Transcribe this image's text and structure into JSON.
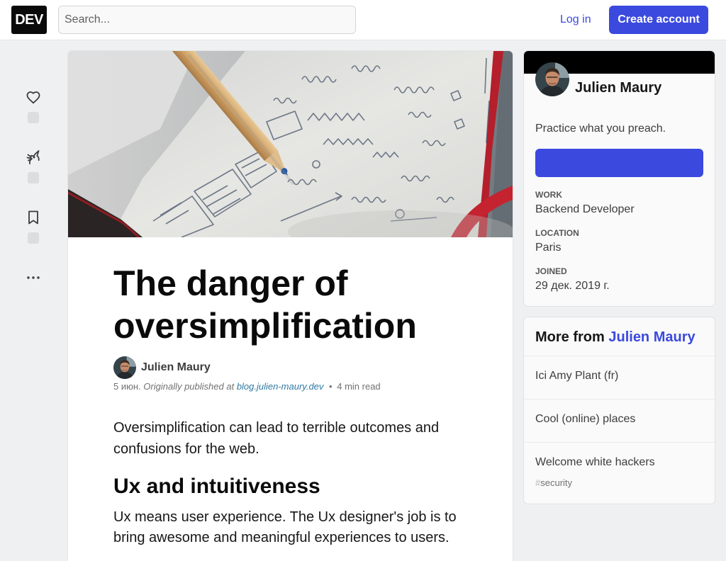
{
  "header": {
    "logo": "DEV",
    "search_placeholder": "Search...",
    "login_label": "Log in",
    "create_account_label": "Create account"
  },
  "reactions": {
    "icons": [
      "heart-icon",
      "unicorn-icon",
      "bookmark-icon",
      "more-icon"
    ]
  },
  "article": {
    "title": "The danger of oversimplification",
    "author": "Julien Maury",
    "meta": {
      "date": "5 июн.",
      "originally_published": "Originally published at",
      "source_link": "blog.julien-maury.dev",
      "separator": "•",
      "read_time": "4 min read"
    },
    "intro": "Oversimplification can lead to terrible outcomes and confusions for the web.",
    "heading": "Ux and intuitiveness",
    "paragraph": "Ux means user experience. The Ux designer's job is to bring awesome and meaningful experiences to users."
  },
  "author_card": {
    "name": "Julien Maury",
    "bio": "Practice what you preach.",
    "details": [
      {
        "label": "WORK",
        "value": "Backend Developer"
      },
      {
        "label": "LOCATION",
        "value": "Paris"
      },
      {
        "label": "JOINED",
        "value": "29 дек. 2019 г."
      }
    ]
  },
  "more_from": {
    "prefix": "More from",
    "author": "Julien Maury",
    "items": [
      {
        "title": "Ici Amy Plant (fr)"
      },
      {
        "title": "Cool (online) places"
      },
      {
        "title": "Welcome white hackers",
        "tag_hash": "#",
        "tag": "security"
      }
    ]
  },
  "colors": {
    "accent": "#3b49df",
    "page_background": "#eef0f1",
    "card": "#ffffff",
    "text": "#171717",
    "muted": "#717171",
    "banner": "#000000"
  }
}
